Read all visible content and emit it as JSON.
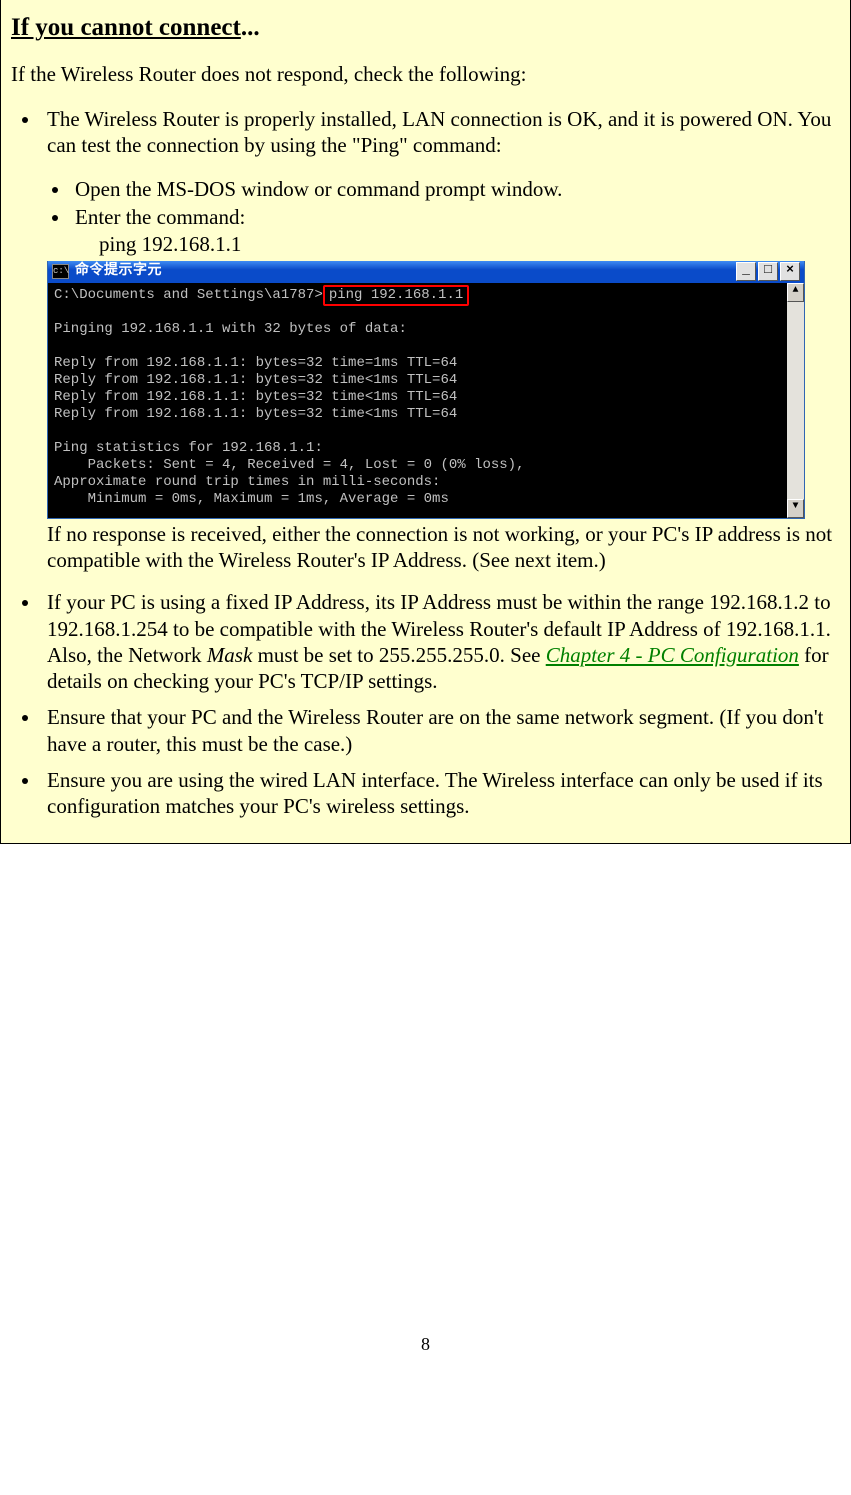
{
  "heading": {
    "underlined": "If you cannot connect",
    "suffix": "..."
  },
  "intro": "If the Wireless  Router does not respond, check the following:",
  "bullets": {
    "b1": "The Wireless  Router is properly installed, LAN connection is OK, and it is powered ON. You can test the connection by using the \"Ping\" command:",
    "sub1": "Open the MS-DOS window or command prompt window.",
    "sub2": "Enter the command:",
    "cmd": "ping 192.168.1.1",
    "after_shot": "If no response is received, either the connection is not working, or your PC's IP address is not compatible with the Wireless  Router's IP Address. (See next item.)",
    "b2_pre": "If your PC is using a fixed IP Address, its IP Address must be within the range 192.168.1.2 to 192.168.1.254 to be compatible with the Wireless  Router's default IP Address of 192.168.1.1. Also, the Network ",
    "b2_mask": "Mask",
    "b2_mid": " must be set to 255.255.255.0. See ",
    "b2_link": "Chapter 4 - PC Configuration",
    "b2_post": " for details on checking your PC's TCP/IP settings.",
    "b3": "Ensure that your PC and the Wireless  Router are on the same network segment. (If you don't have a router, this must be the case.)",
    "b4": "Ensure you are using the wired LAN interface. The Wireless interface can only be used if its configuration matches your PC's wireless settings."
  },
  "terminal": {
    "title": "命令提示字元",
    "icon_text": "c:\\",
    "btn_min": "_",
    "btn_max": "□",
    "btn_close": "×",
    "sb_up": "▲",
    "sb_down": "▼",
    "prompt": "C:\\Documents and Settings\\a1787>",
    "hl_cmd": "ping 192.168.1.1",
    "line_blank": "",
    "line1": "Pinging 192.168.1.1 with 32 bytes of data:",
    "reply1": "Reply from 192.168.1.1: bytes=32 time=1ms TTL=64",
    "reply2": "Reply from 192.168.1.1: bytes=32 time<1ms TTL=64",
    "reply3": "Reply from 192.168.1.1: bytes=32 time<1ms TTL=64",
    "reply4": "Reply from 192.168.1.1: bytes=32 time<1ms TTL=64",
    "stats_hdr": "Ping statistics for 192.168.1.1:",
    "stats1": "    Packets: Sent = 4, Received = 4, Lost = 0 (0% loss),",
    "stats2": "Approximate round trip times in milli-seconds:",
    "stats3": "    Minimum = 0ms, Maximum = 1ms, Average = 0ms"
  },
  "page_number": "8"
}
